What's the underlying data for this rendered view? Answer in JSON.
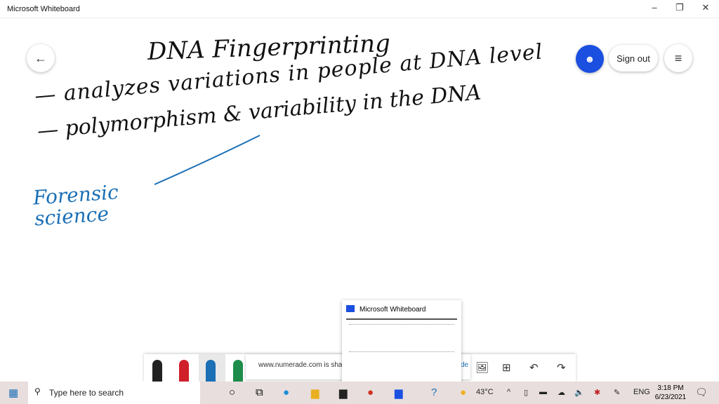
{
  "window": {
    "title": "Microsoft Whiteboard",
    "minimize": "–",
    "restore": "❐",
    "close": "✕"
  },
  "header": {
    "back_icon": "←",
    "invite_icon": "person-add",
    "sign_out": "Sign out",
    "menu_icon": "≡"
  },
  "board": {
    "title": "DNA Fingerprinting",
    "line1": "— analyzes variations in people at DNA level",
    "line2": "— polymorphism & variability in the DNA",
    "note": "Forensic science",
    "ink_color": "#111111",
    "note_color": "#1a6fb5"
  },
  "toolbar": {
    "pens": [
      "#222222",
      "#d0202a",
      "#1a6fb5",
      "#1e8c4a"
    ],
    "image_icon": "🖼",
    "add_icon": "⊞",
    "undo_icon": "↶",
    "redo_icon": "↷"
  },
  "share_bar": {
    "text": "www.numerade.com is shari",
    "trailing": "de"
  },
  "preview": {
    "title": "Microsoft Whiteboard"
  },
  "taskbar": {
    "search_placeholder": "Type here to search",
    "weather": "43°C",
    "language": "ENG",
    "time": "3:18 PM",
    "date": "6/23/2021"
  }
}
